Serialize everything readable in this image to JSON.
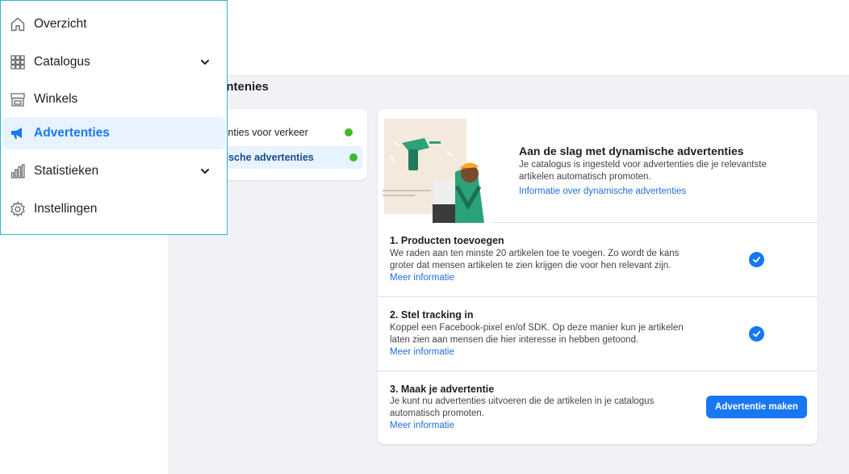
{
  "menu": {
    "items": [
      {
        "label": "Overzicht",
        "icon": "home-icon"
      },
      {
        "label": "Catalogus",
        "icon": "grid-icon",
        "expandable": true
      },
      {
        "label": "Winkels",
        "icon": "store-icon"
      },
      {
        "label": "Advertenties",
        "icon": "megaphone-icon",
        "active": true
      },
      {
        "label": "Statistieken",
        "icon": "bar-chart-icon",
        "expandable": true
      },
      {
        "label": "Instellingen",
        "icon": "gear-icon"
      }
    ]
  },
  "section_title": "entenies",
  "left_nav": {
    "items": [
      {
        "label": "tenties voor verkeer",
        "status": "green"
      },
      {
        "label": "nische advertenties",
        "status": "green",
        "active": true
      }
    ]
  },
  "hero": {
    "title": "Aan de slag met dynamische advertenties",
    "description": "Je catalogus is ingesteld voor advertenties die je relevantste artikelen automatisch promoten.",
    "link": "Informatie over dynamische advertenties"
  },
  "steps": [
    {
      "title": "1. Producten toevoegen",
      "description": "We raden aan ten minste 20 artikelen toe te voegen. Zo wordt de kans groter dat mensen artikelen te zien krijgen die voor hen relevant zijn.",
      "link": "Meer informatie",
      "done": true
    },
    {
      "title": "2. Stel tracking in",
      "description": "Koppel een Facebook-pixel en/of SDK. Op deze manier kun je artikelen laten zien aan mensen die hier interesse in hebben getoond.",
      "link": "Meer informatie",
      "done": true
    },
    {
      "title": "3. Maak je advertentie",
      "description": "Je kunt nu advertenties uitvoeren die de artikelen in je catalogus automatisch promoten.",
      "link": "Meer informatie",
      "button": "Advertentie maken"
    }
  ],
  "colors": {
    "accent": "#1877f2",
    "status_green": "#42b72a",
    "menu_border": "#29b6d6",
    "background": "#f0f2f5"
  }
}
